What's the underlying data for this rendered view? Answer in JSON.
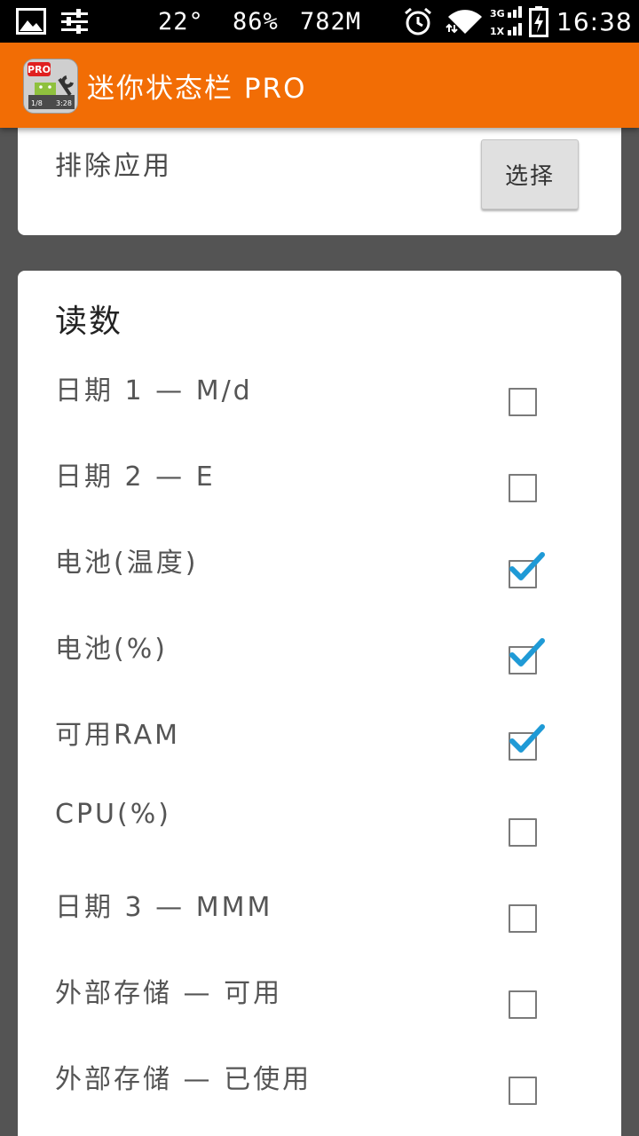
{
  "status_bar": {
    "temperature": "22°",
    "battery_percent": "86%",
    "ram": "782M",
    "network": "3G 1X",
    "time": "16:38"
  },
  "action_bar": {
    "title": "迷你状态栏 PRO",
    "icon_badge": "PRO",
    "icon_left_text": "1/8",
    "icon_right_text": "3:28"
  },
  "exclude_apps": {
    "label": "排除应用",
    "button_label": "选择"
  },
  "readings": {
    "title": "读数",
    "items": [
      {
        "label": "日期 1 — M/d",
        "checked": false
      },
      {
        "label": "日期 2 — E",
        "checked": false
      },
      {
        "label": "电池(温度)",
        "checked": true
      },
      {
        "label": "电池(%)",
        "checked": true
      },
      {
        "label": "可用RAM",
        "checked": true
      },
      {
        "label": "CPU(%)",
        "checked": false
      },
      {
        "label": "日期 3 — MMM",
        "checked": false
      },
      {
        "label": "外部存储 — 可用",
        "checked": false
      },
      {
        "label": "外部存储 — 已使用",
        "checked": false
      }
    ]
  },
  "colors": {
    "action_bar": "#f26d05",
    "background": "#545454",
    "checkmark": "#1f9ad6"
  }
}
